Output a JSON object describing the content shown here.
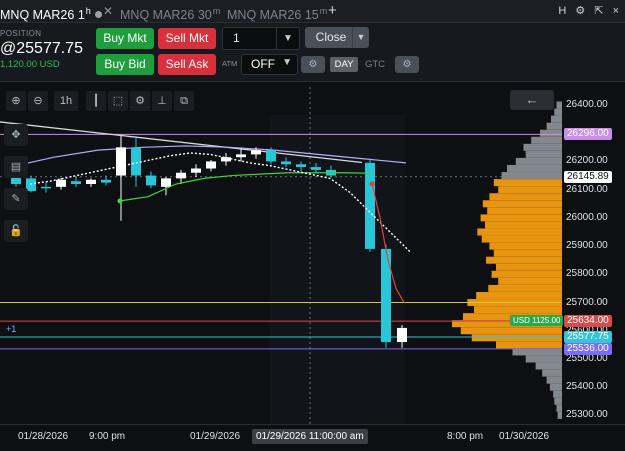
{
  "tabs": [
    {
      "label": "MNQ MAR26",
      "interval": "1",
      "sup": "h",
      "active": true
    },
    {
      "label": "MNQ MAR26",
      "interval": "30",
      "sup": "m",
      "active": false
    },
    {
      "label": "MNQ MAR26",
      "interval": "15",
      "sup": "m",
      "active": false
    }
  ],
  "tab_add_icon": "+",
  "top_icons": {
    "h": "H",
    "gear": "⚙",
    "detach": "⇱",
    "close": "×"
  },
  "position": {
    "label": "POSITION",
    "value": "@25577.75",
    "pnl": "1,120.00 USD"
  },
  "order": {
    "buy_mkt": "Buy Mkt",
    "sell_mkt": "Sell Mkt",
    "buy_bid": "Buy Bid",
    "sell_ask": "Sell Ask",
    "quantity": "1",
    "close": "Close",
    "atm_label": "ATM",
    "atm_value": "OFF",
    "day": "DAY",
    "gtc": "GTC"
  },
  "toolbar": {
    "interval": "1h"
  },
  "price_axis": {
    "ticks": [
      "26400.00",
      "26300.00",
      "26200.00",
      "26100.00",
      "26000.00",
      "25900.00",
      "25800.00",
      "25700.00",
      "25600.00",
      "25500.00",
      "25400.00",
      "25300.00"
    ],
    "labels": [
      {
        "text": "26296.00",
        "color": "#c98ee8"
      },
      {
        "text": "26145.89",
        "color": "#ffffff"
      },
      {
        "text": "25634.00",
        "color": "#d94a4a"
      },
      {
        "text": "25577.75",
        "color": "#35c4d8"
      },
      {
        "text": "25536.00",
        "color": "#7b6cf6"
      }
    ],
    "usd_badge": "USD 1125.00"
  },
  "plus_one": "+1",
  "x_axis": {
    "labels": [
      "01/28/2026",
      "9:00 pm",
      "01/29/2026",
      "01/29/2026 11:00:00 am",
      "8:00 pm",
      "01/30/2026"
    ]
  },
  "colors": {
    "up": "#ffffff",
    "down": "#27c6d9",
    "ema": "#3ad93a",
    "volume_profile": "#f39c12",
    "poc": "#c98ee8"
  },
  "chart_data": {
    "type": "candlestick",
    "title": "",
    "xlabel": "",
    "ylabel": "",
    "ylim": [
      25250,
      26450
    ],
    "candles": [
      {
        "o": 26180,
        "h": 26215,
        "l": 26110,
        "c": 26120
      },
      {
        "o": 26140,
        "h": 26150,
        "l": 26090,
        "c": 26095
      },
      {
        "o": 26110,
        "h": 26125,
        "l": 26090,
        "c": 26105
      },
      {
        "o": 26110,
        "h": 26140,
        "l": 26100,
        "c": 26135
      },
      {
        "o": 26130,
        "h": 26145,
        "l": 26110,
        "c": 26120
      },
      {
        "o": 26120,
        "h": 26140,
        "l": 26110,
        "c": 26135
      },
      {
        "o": 26135,
        "h": 26150,
        "l": 26115,
        "c": 26125
      },
      {
        "o": 26150,
        "h": 26290,
        "l": 25990,
        "c": 26250
      },
      {
        "o": 26250,
        "h": 26290,
        "l": 26110,
        "c": 26150
      },
      {
        "o": 26150,
        "h": 26165,
        "l": 26105,
        "c": 26115
      },
      {
        "o": 26110,
        "h": 26145,
        "l": 26080,
        "c": 26140
      },
      {
        "o": 26140,
        "h": 26170,
        "l": 26120,
        "c": 26160
      },
      {
        "o": 26160,
        "h": 26190,
        "l": 26145,
        "c": 26175
      },
      {
        "o": 26175,
        "h": 26205,
        "l": 26165,
        "c": 26200
      },
      {
        "o": 26200,
        "h": 26230,
        "l": 26185,
        "c": 26215
      },
      {
        "o": 26215,
        "h": 26245,
        "l": 26200,
        "c": 26225
      },
      {
        "o": 26225,
        "h": 26250,
        "l": 26210,
        "c": 26240
      },
      {
        "o": 26240,
        "h": 26250,
        "l": 26190,
        "c": 26200
      },
      {
        "o": 26200,
        "h": 26215,
        "l": 26180,
        "c": 26190
      },
      {
        "o": 26190,
        "h": 26200,
        "l": 26165,
        "c": 26180
      },
      {
        "o": 26180,
        "h": 26195,
        "l": 26160,
        "c": 26170
      },
      {
        "o": 26170,
        "h": 26185,
        "l": 26145,
        "c": 26150
      },
      {
        "o": 26195,
        "h": 26210,
        "l": 25880,
        "c": 25890
      },
      {
        "o": 25890,
        "h": 25905,
        "l": 25540,
        "c": 25560
      },
      {
        "o": 25560,
        "h": 25620,
        "l": 25540,
        "c": 25610
      }
    ],
    "volume_profile": [
      {
        "price": 26400,
        "vol": 0.05
      },
      {
        "price": 26375,
        "vol": 0.07
      },
      {
        "price": 26350,
        "vol": 0.1
      },
      {
        "price": 26325,
        "vol": 0.14
      },
      {
        "price": 26300,
        "vol": 0.2
      },
      {
        "price": 26275,
        "vol": 0.28
      },
      {
        "price": 26250,
        "vol": 0.35
      },
      {
        "price": 26225,
        "vol": 0.33
      },
      {
        "price": 26200,
        "vol": 0.42
      },
      {
        "price": 26175,
        "vol": 0.5
      },
      {
        "price": 26150,
        "vol": 0.55
      },
      {
        "price": 26125,
        "vol": 0.62
      },
      {
        "price": 26100,
        "vol": 0.58
      },
      {
        "price": 26075,
        "vol": 0.66
      },
      {
        "price": 26050,
        "vol": 0.72
      },
      {
        "price": 26025,
        "vol": 0.68
      },
      {
        "price": 26000,
        "vol": 0.74
      },
      {
        "price": 25975,
        "vol": 0.7
      },
      {
        "price": 25950,
        "vol": 0.77
      },
      {
        "price": 25925,
        "vol": 0.73
      },
      {
        "price": 25900,
        "vol": 0.66
      },
      {
        "price": 25875,
        "vol": 0.62
      },
      {
        "price": 25850,
        "vol": 0.69
      },
      {
        "price": 25825,
        "vol": 0.6
      },
      {
        "price": 25800,
        "vol": 0.64
      },
      {
        "price": 25775,
        "vol": 0.58
      },
      {
        "price": 25750,
        "vol": 0.67
      },
      {
        "price": 25725,
        "vol": 0.78
      },
      {
        "price": 25700,
        "vol": 0.86
      },
      {
        "price": 25675,
        "vol": 0.8
      },
      {
        "price": 25650,
        "vol": 0.9
      },
      {
        "price": 25625,
        "vol": 1.0
      },
      {
        "price": 25600,
        "vol": 0.92
      },
      {
        "price": 25575,
        "vol": 0.82
      },
      {
        "price": 25550,
        "vol": 0.6
      },
      {
        "price": 25525,
        "vol": 0.45
      },
      {
        "price": 25500,
        "vol": 0.33
      },
      {
        "price": 25475,
        "vol": 0.24
      },
      {
        "price": 25450,
        "vol": 0.18
      },
      {
        "price": 25425,
        "vol": 0.14
      },
      {
        "price": 25400,
        "vol": 0.11
      },
      {
        "price": 25375,
        "vol": 0.08
      },
      {
        "price": 25350,
        "vol": 0.07
      },
      {
        "price": 25325,
        "vol": 0.05
      },
      {
        "price": 25300,
        "vol": 0.04
      }
    ],
    "hlines": [
      {
        "price": 26296,
        "color": "#c98ee8"
      },
      {
        "price": 25700,
        "color": "#d6c63a"
      },
      {
        "price": 25634,
        "color": "#d94a4a"
      },
      {
        "price": 25577.75,
        "color": "#35c4d8"
      },
      {
        "price": 25536,
        "color": "#7b6cf6"
      }
    ],
    "ema": [
      26060,
      26075,
      26120,
      26140,
      26150,
      26155,
      26160,
      26160,
      26160,
      26158
    ],
    "ma_dotted": [
      26120,
      26130,
      26145,
      26160,
      26175,
      26190,
      26205,
      26220,
      26230,
      26225,
      26210,
      26195,
      26185,
      26170,
      26155,
      26140,
      26090,
      26020,
      25950,
      25880
    ],
    "resistance_line": [
      26340,
      26260
    ],
    "upper_curve": [
      26180,
      26215,
      26240,
      26250,
      26255,
      26250,
      26240,
      26225,
      26210,
      26195
    ],
    "red_line": [
      26120,
      26000,
      25850,
      25750,
      25700
    ]
  }
}
